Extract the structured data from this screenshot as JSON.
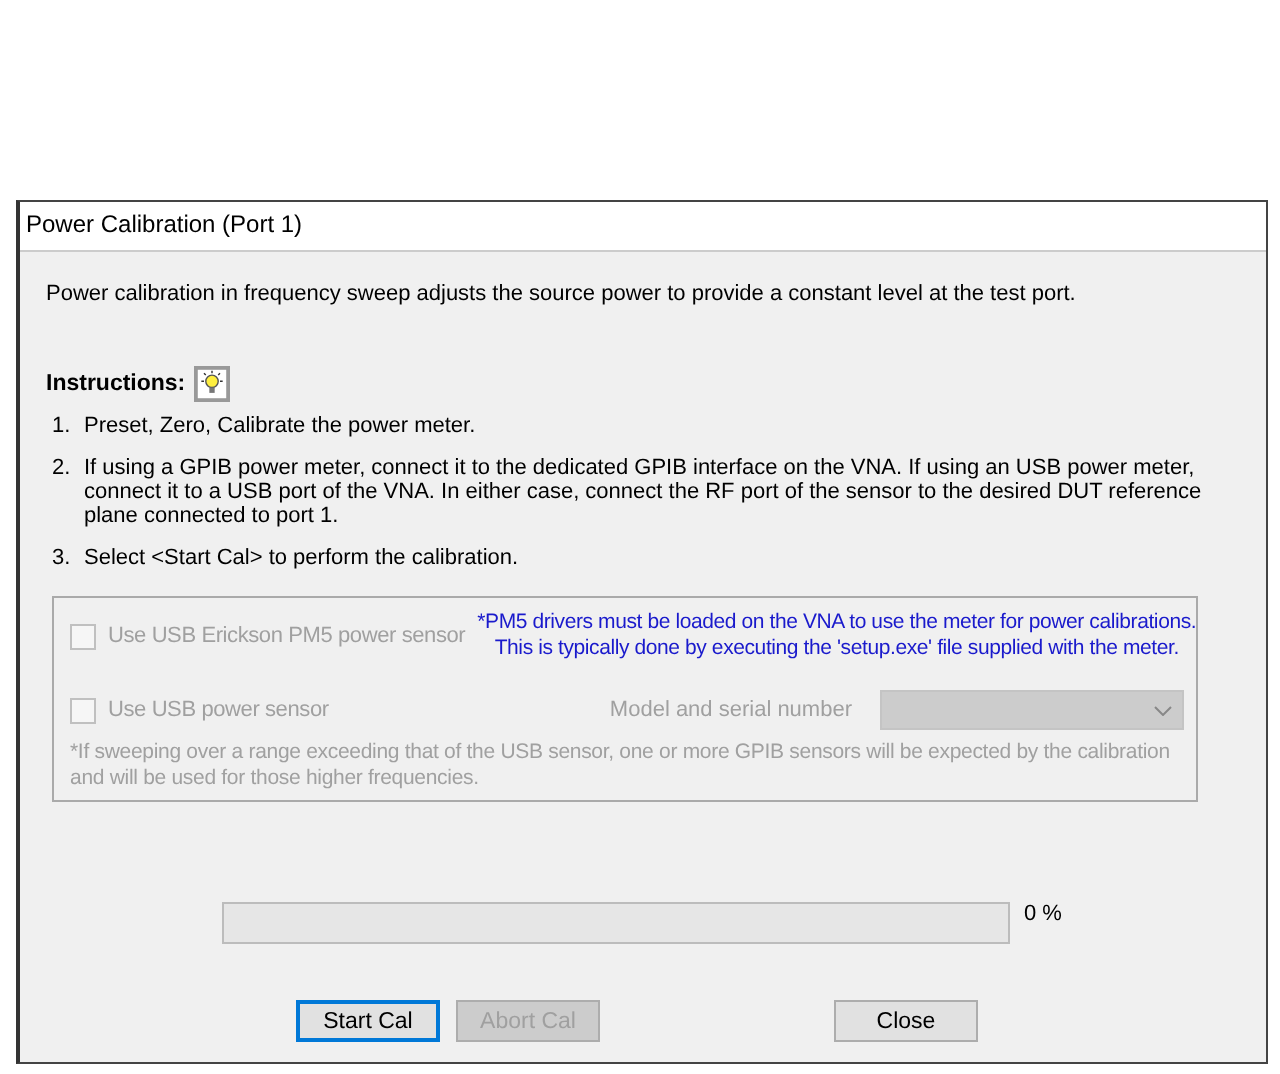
{
  "window": {
    "title": "Power Calibration (Port 1)"
  },
  "intro": "Power calibration in frequency sweep adjusts the source power to provide a constant level at the test port.",
  "instructions": {
    "heading": "Instructions:",
    "steps": [
      {
        "number": "1.",
        "text": "Preset, Zero, Calibrate the power meter."
      },
      {
        "number": "2.",
        "text": "If using a GPIB power meter, connect it to the dedicated GPIB interface on the VNA.  If using an USB power meter, connect it to a USB port of the VNA.  In either case, connect the RF port of the sensor to the desired DUT reference plane connected to port 1."
      },
      {
        "number": "3.",
        "text": "Select <Start Cal> to perform the calibration."
      }
    ]
  },
  "sensor_options": {
    "pm5": {
      "label": "Use USB Erickson PM5 power sensor",
      "checked": false,
      "disabled": true
    },
    "pm5_note": "*PM5 drivers must be loaded on the VNA to use the meter for power calibrations.\nThis is typically done by executing the 'setup.exe' file supplied with the meter.",
    "usb": {
      "label": "Use USB power sensor",
      "checked": false,
      "disabled": true
    },
    "model_label": "Model and serial number",
    "model_dropdown": {
      "disabled": true
    },
    "footnote": "*If sweeping over a range exceeding that of the USB sensor, one or more GPIB sensors will be expected by the calibration and will be used for those higher frequencies."
  },
  "progress": {
    "level": 0,
    "reading": "0 %"
  },
  "buttons": [
    {
      "label": "Start Cal",
      "kind": "default",
      "disabled": false
    },
    {
      "label": "Abort Cal",
      "kind": "normal",
      "disabled": true
    },
    {
      "label": "Close",
      "kind": "normal",
      "disabled": false
    }
  ]
}
